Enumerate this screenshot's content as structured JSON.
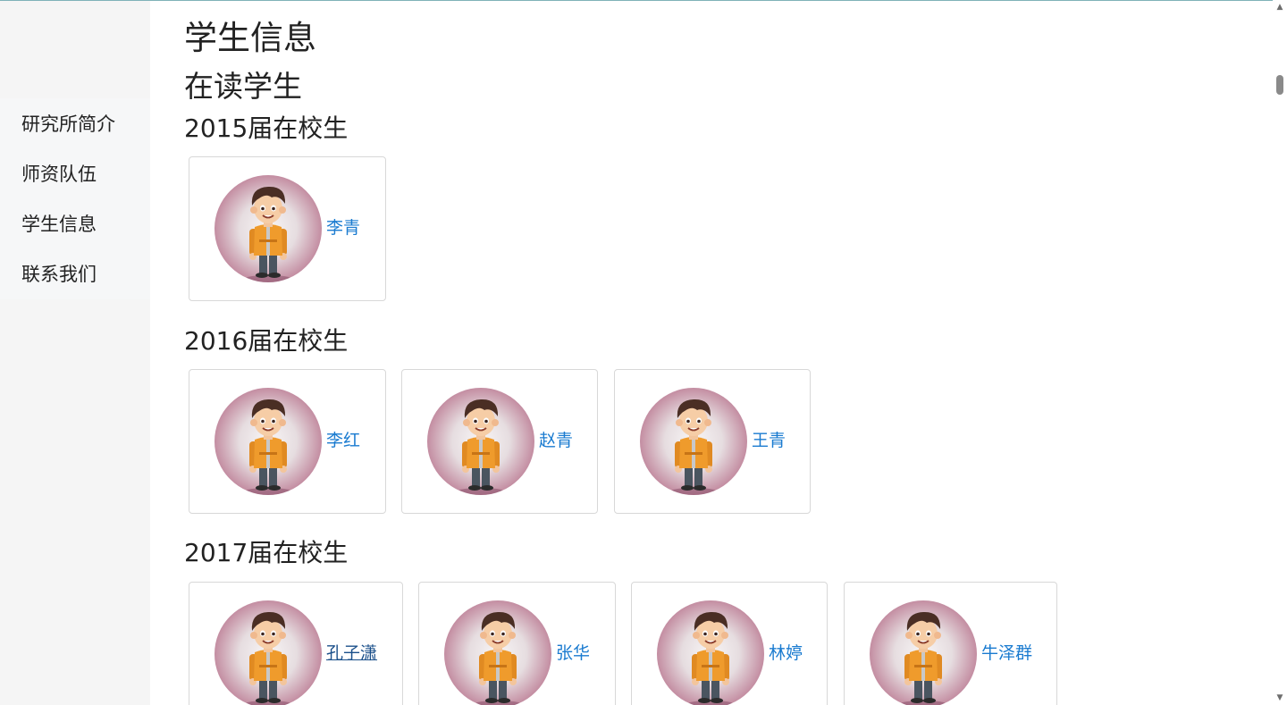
{
  "page": {
    "title": "学生信息",
    "subtitle": "在读学生"
  },
  "sidebar": {
    "items": [
      {
        "label": "研究所简介"
      },
      {
        "label": "师资队伍"
      },
      {
        "label": "学生信息"
      },
      {
        "label": "联系我们"
      }
    ]
  },
  "classes": [
    {
      "title": "2015届在校生",
      "students": [
        {
          "name": "李青"
        }
      ]
    },
    {
      "title": "2016届在校生",
      "students": [
        {
          "name": "李红"
        },
        {
          "name": "赵青"
        },
        {
          "name": "王青"
        }
      ]
    },
    {
      "title": "2017届在校生",
      "students": [
        {
          "name": "孔子潇"
        },
        {
          "name": "张华"
        },
        {
          "name": "林婷"
        },
        {
          "name": "牛泽群"
        }
      ]
    }
  ],
  "icons": {
    "avatar": "cartoon-boy-avatar",
    "scroll_up": "triangle-up-icon",
    "scroll_down": "triangle-down-icon"
  },
  "colors": {
    "link": "#1a7bd0",
    "sidebar_bg": "#f5f5f5",
    "avatar_ring": "#a85b7e"
  }
}
